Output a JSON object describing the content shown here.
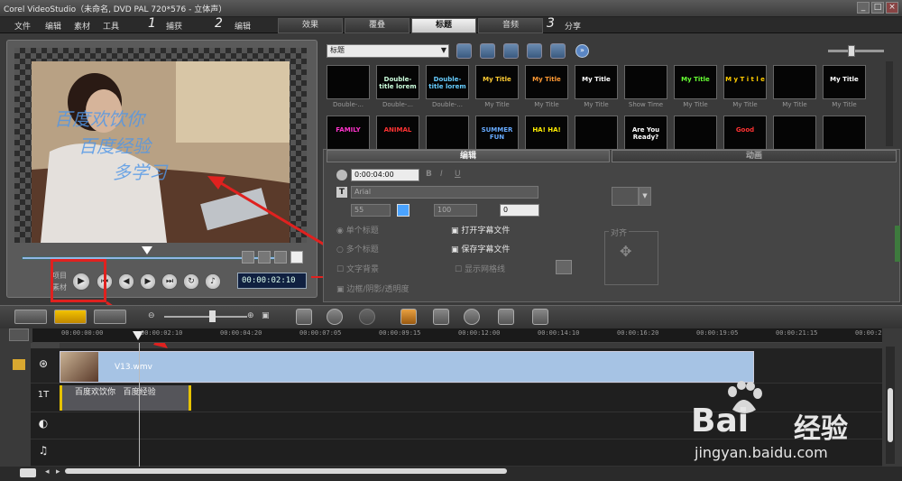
{
  "window": {
    "title": "Corel VideoStudio（未命名, DVD PAL 720*576 - 立体声）",
    "min": "_",
    "max": "□",
    "close": "×"
  },
  "menu": {
    "items": [
      "文件",
      "编辑",
      "素材",
      "工具"
    ]
  },
  "steps": [
    {
      "num": "1",
      "label": "捕获"
    },
    {
      "num": "2",
      "label": "编辑"
    },
    {
      "num": "3",
      "label": "分享"
    }
  ],
  "tabs": [
    {
      "label": "效果",
      "active": false
    },
    {
      "label": "覆叠",
      "active": false
    },
    {
      "label": "标题",
      "active": true
    },
    {
      "label": "音频",
      "active": false
    }
  ],
  "preview": {
    "overlay_lines": [
      "百度欢饮你",
      "百度经验",
      "多学习"
    ],
    "mode_labels": [
      "项目",
      "素材"
    ],
    "timecode": "00:00:02:10"
  },
  "library": {
    "dropdown_value": "标题",
    "thumbs": [
      {
        "text": "",
        "cap": "Double-..."
      },
      {
        "text": "Double-title lorem",
        "cap": "Double-..."
      },
      {
        "text": "Double-title lorem",
        "cap": "Double-..."
      },
      {
        "text": "My Title",
        "cap": "My Title"
      },
      {
        "text": "My Title",
        "cap": "My Title"
      },
      {
        "text": "My Title",
        "cap": "My Title"
      },
      {
        "text": "",
        "cap": "Show Time"
      },
      {
        "text": "My Title",
        "cap": "My Title"
      },
      {
        "text": "M y T i t l e",
        "cap": "My Title"
      },
      {
        "text": "",
        "cap": "My Title"
      },
      {
        "text": "My Title",
        "cap": "My Title"
      },
      {
        "text": "FAMILY",
        "cap": ""
      },
      {
        "text": "ANIMAL",
        "cap": ""
      },
      {
        "text": "",
        "cap": ""
      },
      {
        "text": "SUMMER FUN",
        "cap": ""
      },
      {
        "text": "HA! HA!",
        "cap": ""
      },
      {
        "text": "",
        "cap": ""
      },
      {
        "text": "Are You Ready?",
        "cap": ""
      },
      {
        "text": "",
        "cap": ""
      },
      {
        "text": "Good",
        "cap": ""
      },
      {
        "text": "",
        "cap": ""
      },
      {
        "text": "",
        "cap": ""
      }
    ]
  },
  "options": {
    "tab_edit": "编辑",
    "tab_anim": "动画",
    "duration": "0:00:04:00",
    "font": "Arial",
    "size": "55",
    "line_spacing": "100",
    "angle": "0",
    "single_title": "单个标题",
    "multi_title": "多个标题",
    "text_bg": "文字背景",
    "open_subtitle": "打开字幕文件",
    "save_subtitle": "保存字幕文件",
    "show_grid": "显示网格线",
    "border": "边框/阴影/透明度",
    "align": "对齐"
  },
  "timeline": {
    "ruler": [
      "00:00:00:00",
      "00:00:02:10",
      "00:00:04:20",
      "00:00:07:05",
      "00:00:09:15",
      "00:00:12:00",
      "00:00:14:10",
      "00:00:16:20",
      "00:00:19:05",
      "00:00:21:15",
      "00:00:2"
    ],
    "video_clip": "V13.wmv",
    "title_clip": "百度欢饮你   百度经验"
  },
  "watermark": {
    "brand": "Bai",
    "brand2": "经验",
    "url": "jingyan.baidu.com"
  }
}
